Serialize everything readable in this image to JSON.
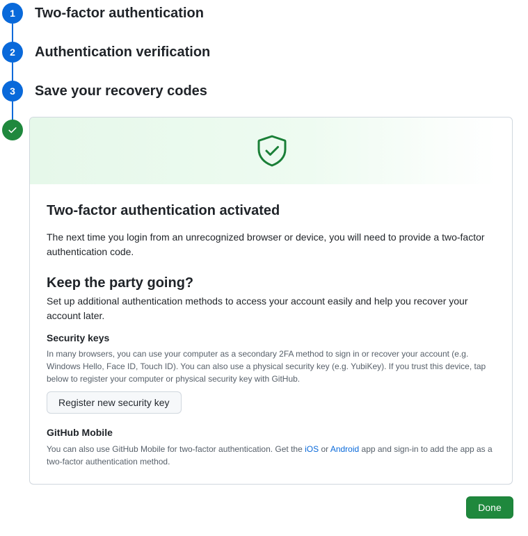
{
  "steps": [
    {
      "number": "1",
      "title": "Two-factor authentication"
    },
    {
      "number": "2",
      "title": "Authentication verification"
    },
    {
      "number": "3",
      "title": "Save your recovery codes"
    }
  ],
  "done_step_icon": "check-icon",
  "colors": {
    "step_blue": "#0969da",
    "success_green": "#1f883d",
    "link": "#0969da"
  },
  "card": {
    "banner_icon": "shield-check-icon",
    "title": "Two-factor authentication activated",
    "description": "The next time you login from an unrecognized browser or device, you will need to provide a two-factor authentication code.",
    "party_title": "Keep the party going?",
    "party_description": "Set up additional authentication methods to access your account easily and help you recover your account later.",
    "security_keys": {
      "title": "Security keys",
      "description": "In many browsers, you can use your computer as a secondary 2FA method to sign in or recover your account (e.g. Windows Hello, Face ID, Touch ID). You can also use a physical security key (e.g. YubiKey). If you trust this device, tap below to register your computer or physical security key with GitHub.",
      "button_label": "Register new security key"
    },
    "github_mobile": {
      "title": "GitHub Mobile",
      "text_before": "You can also use GitHub Mobile for two-factor authentication. Get the ",
      "ios_link": "iOS",
      "text_or": " or ",
      "android_link": "Android",
      "text_after": " app and sign-in to add the app as a two-factor authentication method."
    }
  },
  "done_button_label": "Done"
}
